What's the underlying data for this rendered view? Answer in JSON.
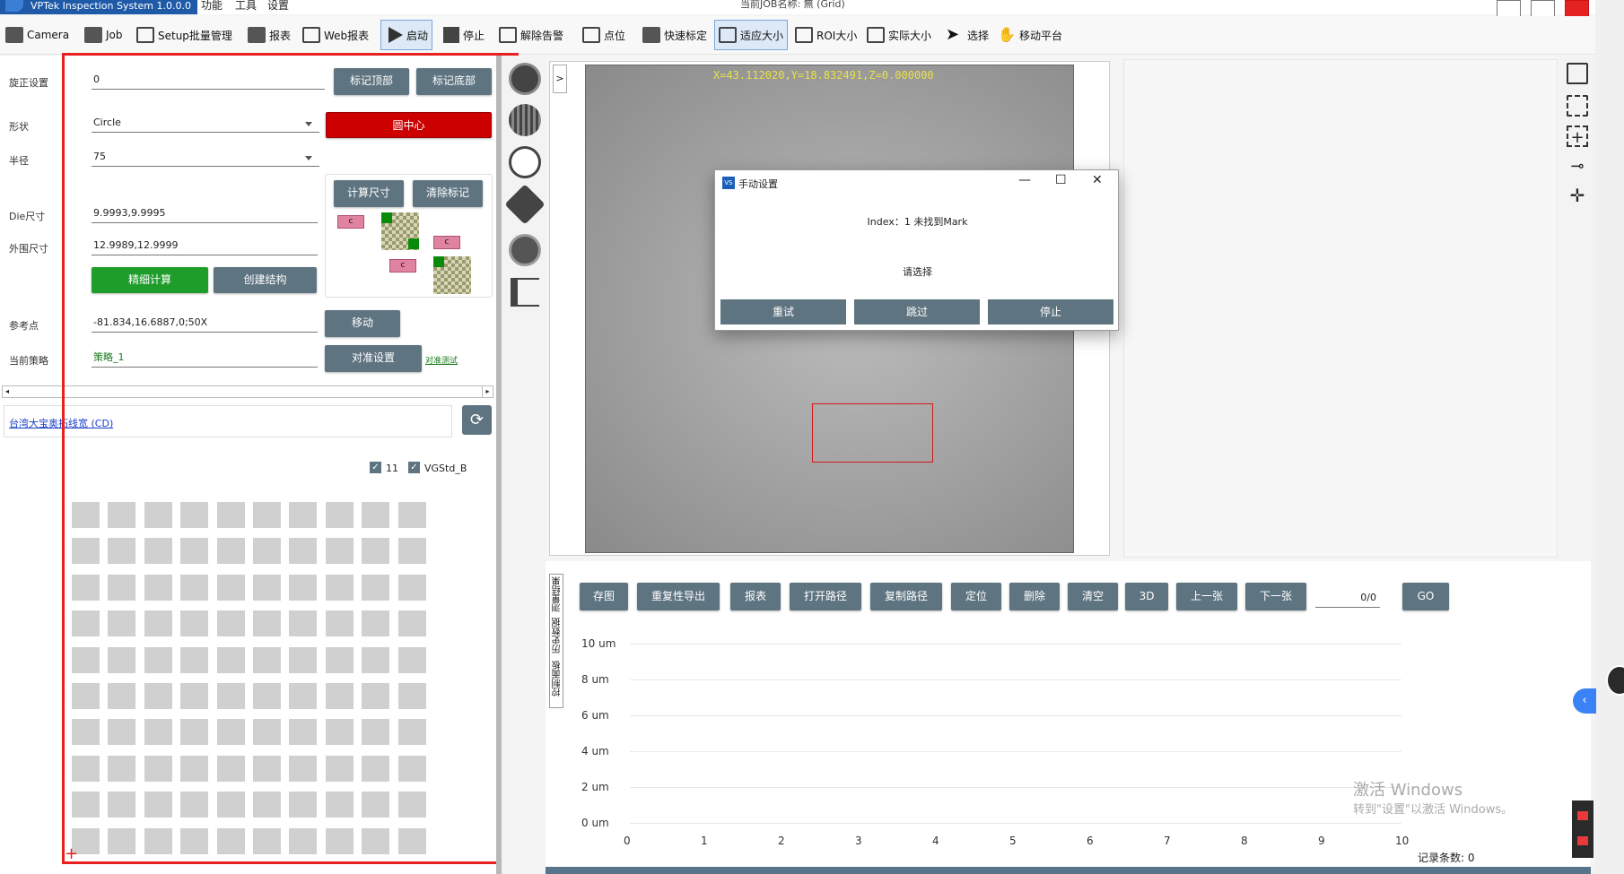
{
  "app": {
    "title": "VPTek Inspection System 1.0.0.0",
    "menu": [
      "功能",
      "工具",
      "设置"
    ],
    "job_title": "当前JOB名称: 無 (Grid)",
    "colors": {
      "accent": "#5f7481",
      "brand": "#1e5aa8",
      "danger": "#cc0000",
      "success": "#1f9d2a"
    }
  },
  "toolbar": {
    "camera": "Camera",
    "job": "Job",
    "setup": "Setup批量管理",
    "report": "报表",
    "web_report": "Web报表",
    "start": "启动",
    "stop": "停止",
    "dismiss_alarm": "解除告警",
    "point": "点位",
    "quick_calib": "快速标定",
    "fit_size": "适应大小",
    "roi_size": "ROI大小",
    "actual_size": "实际大小",
    "select": "选择",
    "move_platform": "移动平台"
  },
  "left_panel": {
    "rotation": {
      "label": "旋正设置",
      "value": "0",
      "btn_top": "标记顶部",
      "btn_bottom": "标记底部"
    },
    "shape": {
      "label": "形状",
      "value": "Circle",
      "btn_center": "圆中心"
    },
    "radius": {
      "label": "半径",
      "value": "75"
    },
    "die_size": {
      "label": "Die尺寸",
      "value": "9.9993,9.9995"
    },
    "outer_size": {
      "label": "外围尺寸",
      "value": "12.9989,12.9999"
    },
    "calc_btn": "计算尺寸",
    "clear_btn": "清除标记",
    "mark_c": "c",
    "fine_calc": "精细计算",
    "create_struct": "创建结构",
    "ref_point": {
      "label": "参考点",
      "value": "-81.834,16.6887,0;50X",
      "btn_move": "移动"
    },
    "strategy": {
      "label": "当前策略",
      "value": "策略_1",
      "btn_align": "对准设置",
      "link_test": "对准测试"
    },
    "link_text": "台湾大宝奥拓线宽 (CD)",
    "check_11": "11",
    "check_vg": "VGStd_B",
    "plus_marker": "+"
  },
  "dialog": {
    "title": "手动设置",
    "icon_text": "VS",
    "minimize": "—",
    "maximize": "☐",
    "close": "✕",
    "message": "Index：1 未找到Mark",
    "prompt": "请选择",
    "retry": "重试",
    "skip": "跳过",
    "stop": "停止"
  },
  "view": {
    "expand": ">",
    "coordinates": "X=43.112020,Y=18.832491,Z=0.000000"
  },
  "bottom": {
    "buttons": [
      "存图",
      "重复性导出",
      "报表",
      "打开路径",
      "复制路径",
      "定位",
      "删除",
      "清空",
      "3D",
      "上一张",
      "下一张"
    ],
    "page": "0/0",
    "go": "GO",
    "tabs": [
      "控制面板",
      "历史数据",
      "测量结果"
    ],
    "record_count": "记录条数: 0",
    "activate_title": "激活 Windows",
    "activate_sub": "转到\"设置\"以激活 Windows。"
  },
  "chart_data": {
    "type": "line",
    "title": "",
    "xlabel": "",
    "ylabel": "",
    "x_ticks": [
      "0",
      "1",
      "2",
      "3",
      "4",
      "5",
      "6",
      "7",
      "8",
      "9",
      "10"
    ],
    "y_ticks": [
      "10 um",
      "8 um",
      "6 um",
      "4 um",
      "2 um",
      "0 um"
    ],
    "xlim": [
      0,
      10
    ],
    "ylim": [
      0,
      10
    ],
    "series": [],
    "grid": true
  }
}
